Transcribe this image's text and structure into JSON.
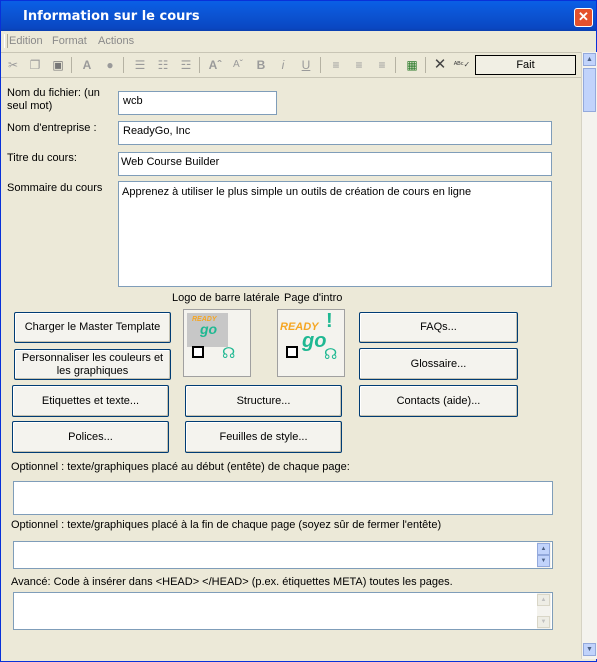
{
  "window": {
    "title": "Information sur le cours",
    "close_glyph": "✕"
  },
  "menu": [
    {
      "label": "Edition"
    },
    {
      "label": "Format"
    },
    {
      "label": "Actions"
    }
  ],
  "toolbar": {
    "done_label": "Fait"
  },
  "fields": {
    "filename_label": "Nom du fichier: (un seul mot)",
    "filename_value": "wcb",
    "company_label": "Nom d'entreprise :",
    "company_value": "ReadyGo, Inc",
    "title_label": "Titre du cours:",
    "title_value": "Web Course Builder",
    "summary_label": "Sommaire du cours",
    "summary_value": "Apprenez à utiliser le plus simple un outils de création de cours en ligne"
  },
  "images": {
    "sidebar_logo_label": "Logo de barre latérale",
    "intro_page_label": "Page d'intro"
  },
  "buttons": {
    "load_master": "Charger le Master Template",
    "customize_colors": "Personnaliser les couleurs et les graphiques",
    "labels_text": "Etiquettes et texte...",
    "fonts": "Polices...",
    "structure": "Structure...",
    "stylesheets": "Feuilles de style...",
    "faqs": "FAQs...",
    "glossary": "Glossaire...",
    "contacts": "Contacts (aide)..."
  },
  "optional": {
    "header_label": "Optionnel : texte/graphiques placé au début (entête) de chaque page:",
    "footer_label": "Optionnel : texte/graphiques placé à la fin de chaque page (soyez sûr de fermer l'entête)",
    "head_label": "Avancé: Code à insérer dans <HEAD> </HEAD> (p.ex. étiquettes META) toutes les pages."
  },
  "logo_text": {
    "ready": "READY",
    "go": "go",
    "ready_small": "READY",
    "go_small": "go"
  },
  "colors": {
    "titlebar": "#0a5fe6",
    "logo_orange": "#f5a623",
    "logo_green": "#1fb892"
  }
}
